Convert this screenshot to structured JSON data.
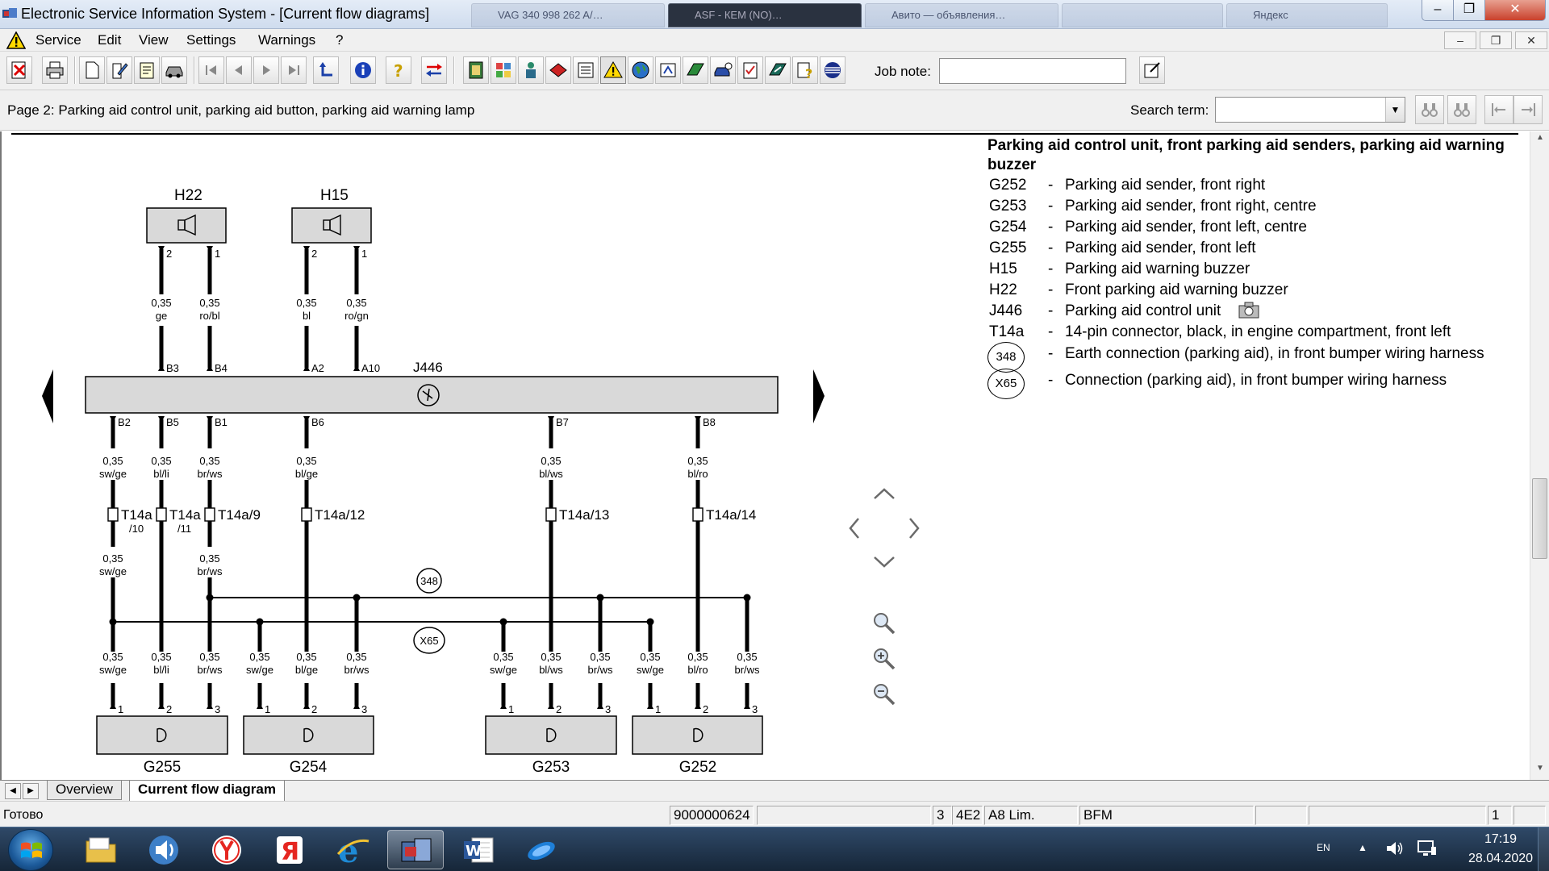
{
  "window": {
    "title": "Electronic Service Information System - [Current flow diagrams]",
    "minimize": "–",
    "maximize": "❐",
    "close": "✕"
  },
  "menu": {
    "items": [
      "Service",
      "Edit",
      "View",
      "Settings",
      "Warnings",
      "?"
    ],
    "mdi_minimize": "–",
    "mdi_restore": "❐",
    "mdi_close": "✕"
  },
  "toolbar": {
    "job_note_label": "Job note:",
    "job_note_value": ""
  },
  "page_header": {
    "title": "Page 2: Parking aid control unit, parking aid button, parking aid warning lamp",
    "search_label": "Search term:",
    "search_value": ""
  },
  "legend": {
    "title": "Parking aid control unit, front parking aid senders, parking aid warning buzzer",
    "entries": [
      {
        "code": "G252",
        "desc": "Parking aid sender, front right"
      },
      {
        "code": "G253",
        "desc": "Parking aid sender, front right, centre"
      },
      {
        "code": "G254",
        "desc": "Parking aid sender, front left, centre"
      },
      {
        "code": "G255",
        "desc": "Parking aid sender, front left"
      },
      {
        "code": "H15",
        "desc": "Parking aid warning buzzer"
      },
      {
        "code": "H22",
        "desc": "Front parking aid warning buzzer"
      },
      {
        "code": "J446",
        "desc": "Parking aid control unit"
      },
      {
        "code": "T14a",
        "desc": "14-pin connector, black, in engine compartment, front left"
      },
      {
        "code": "348",
        "desc": "Earth connection (parking aid), in front bumper wiring harness"
      },
      {
        "code": "X65",
        "desc": "Connection (parking aid), in front bumper wiring harness"
      }
    ],
    "dash": "-"
  },
  "diagram": {
    "buzzers": [
      {
        "name": "H22",
        "pins": [
          "2",
          "1"
        ],
        "wires": [
          {
            "size": "0,35",
            "color": "ge"
          },
          {
            "size": "0,35",
            "color": "ro/bl"
          }
        ],
        "ecu_pins": [
          "B3",
          "B4"
        ]
      },
      {
        "name": "H15",
        "pins": [
          "2",
          "1"
        ],
        "wires": [
          {
            "size": "0,35",
            "color": "bl"
          },
          {
            "size": "0,35",
            "color": "ro/gn"
          }
        ],
        "ecu_pins": [
          "A2",
          "A10"
        ]
      }
    ],
    "ecu_name": "J446",
    "ecu_bottom_pins": [
      "B2",
      "B5",
      "B1",
      "B6",
      "B7",
      "B8"
    ],
    "upper_wires": [
      {
        "size": "0,35",
        "color": "sw/ge"
      },
      {
        "size": "0,35",
        "color": "bl/li"
      },
      {
        "size": "0,35",
        "color": "br/ws"
      },
      {
        "size": "0,35",
        "color": "bl/ge"
      },
      {
        "size": "0,35",
        "color": "bl/ws"
      },
      {
        "size": "0,35",
        "color": "bl/ro"
      }
    ],
    "connectors": [
      "T14a",
      "T14a",
      "T14a/9",
      "T14a/12",
      "T14a/13",
      "T14a/14"
    ],
    "connector_subs": [
      "/10",
      "/11"
    ],
    "mid_wires": [
      {
        "size": "0,35",
        "color": "sw/ge"
      },
      {
        "size": "0,35",
        "color": "br/ws"
      }
    ],
    "junction_348": "348",
    "junction_x65": "X65",
    "lower_wires": [
      {
        "size": "0,35",
        "color": "sw/ge"
      },
      {
        "size": "0,35",
        "color": "bl/li"
      },
      {
        "size": "0,35",
        "color": "br/ws"
      },
      {
        "size": "0,35",
        "color": "sw/ge"
      },
      {
        "size": "0,35",
        "color": "bl/ge"
      },
      {
        "size": "0,35",
        "color": "br/ws"
      },
      {
        "size": "0,35",
        "color": "sw/ge"
      },
      {
        "size": "0,35",
        "color": "bl/ws"
      },
      {
        "size": "0,35",
        "color": "br/ws"
      },
      {
        "size": "0,35",
        "color": "sw/ge"
      },
      {
        "size": "0,35",
        "color": "bl/ro"
      },
      {
        "size": "0,35",
        "color": "br/ws"
      }
    ],
    "sender_pins": [
      "1",
      "2",
      "3"
    ],
    "senders": [
      "G255",
      "G254",
      "G253",
      "G252"
    ]
  },
  "tabs": {
    "overview": "Overview",
    "current": "Current flow diagram"
  },
  "statusbar": {
    "text": "Готово",
    "cells": [
      "9000000624",
      "",
      "3",
      "4E2",
      "A8 Lim.",
      "BFM",
      "",
      "",
      "",
      "",
      "1",
      ""
    ]
  },
  "taskbar": {
    "lang": "EN",
    "time": "17:19",
    "date": "28.04.2020",
    "tray_arrow": "▲"
  },
  "background_tabs": [
    "VAG 340 998 262 A/…",
    "ASF - КЕМ (NO)…",
    "Авито — объявления…",
    "",
    "Яндекс"
  ]
}
